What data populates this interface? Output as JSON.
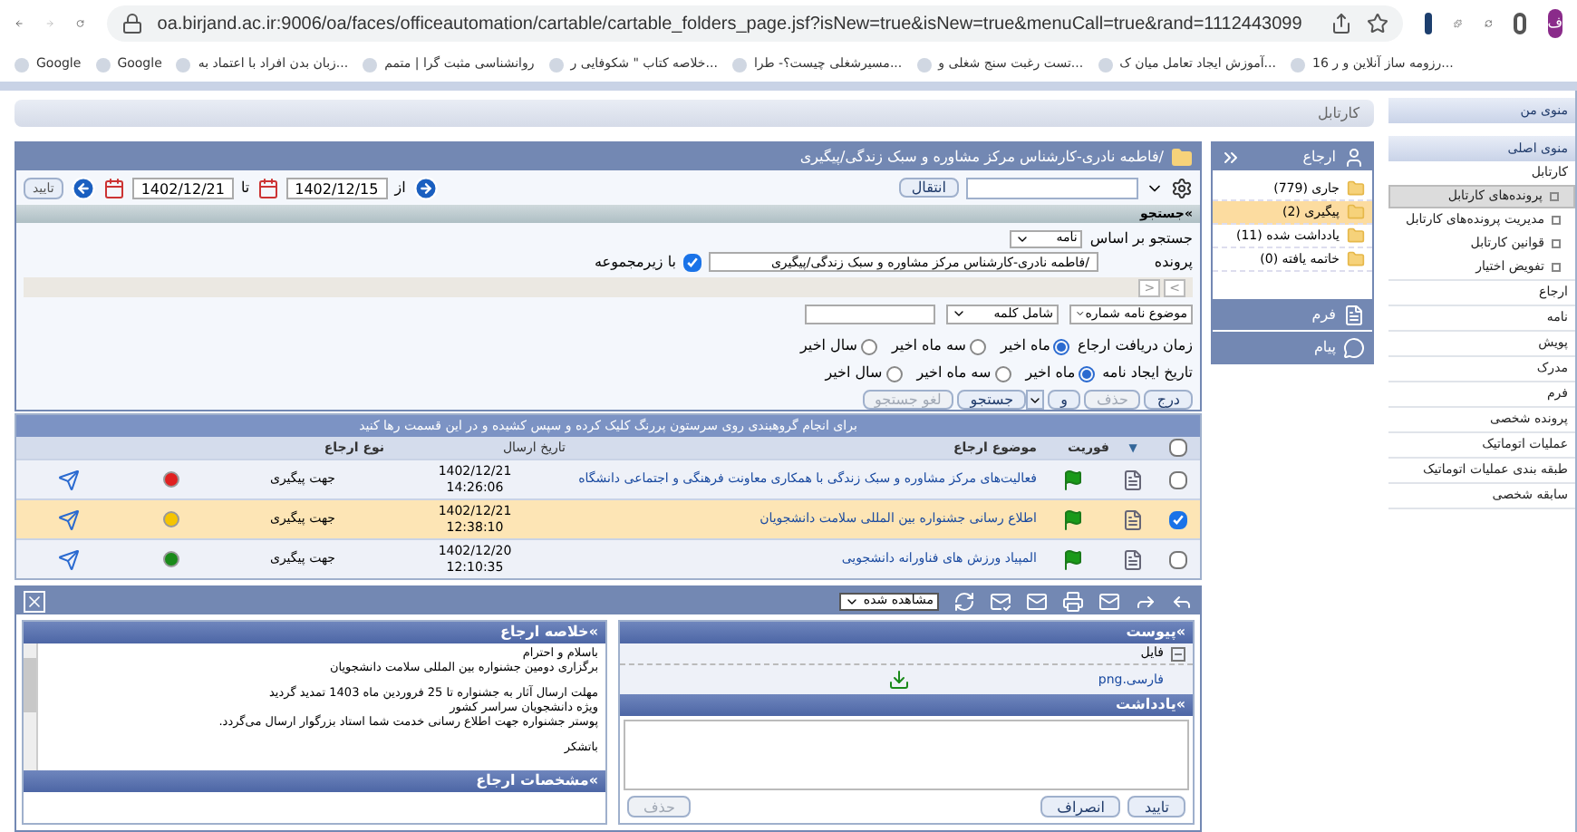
{
  "browser": {
    "url": "oa.birjand.ac.ir:9006/oa/faces/officeautomation/cartable/cartable_folders_page.jsf?isNew=true&isNew=true&menuCall=true&rand=1112443099",
    "profile": "ف",
    "bookmarks": [
      "16 رزومه ساز آنلاین و ر...",
      "آموزش ایجاد تعامل میان ک...",
      "تست رغبت سنج شغلی و...",
      "مسیرشغلی چیست؟- طرا...",
      "خلاصه کتاب \" شکوفایی ر...",
      "روانشناسی مثبت گرا | متمم",
      "زبان بدن افراد با اعتماد به...",
      "Google",
      "Google"
    ]
  },
  "sidebar": {
    "my_menu": "منوی من",
    "main_menu": "منوی اصلی",
    "items": [
      {
        "label": "کارتابل",
        "children": [
          {
            "label": "پرونده‌های کارتابل",
            "selected": true
          },
          {
            "label": "مدیریت پرونده‌های کارتابل",
            "selected": false
          },
          {
            "label": "قوانین کارتابل",
            "selected": false
          },
          {
            "label": "تفویض اختیار",
            "selected": false
          }
        ]
      },
      {
        "label": "ارجاع"
      },
      {
        "label": "نامه"
      },
      {
        "label": "پویش"
      },
      {
        "label": "مدرک"
      },
      {
        "label": "فرم"
      },
      {
        "label": "پرونده شخصی"
      },
      {
        "label": "عملیات اتوماتیک"
      },
      {
        "label": "طبقه بندی عملیات اتوماتیک"
      },
      {
        "label": "سابقه شخصی"
      }
    ]
  },
  "page_title": "کارتابل",
  "cartable": {
    "title": "ارجاع",
    "folders": [
      {
        "name": "جاری",
        "count": "(779)",
        "selected": false
      },
      {
        "name": "پیگیری",
        "count": "(2)",
        "selected": true
      },
      {
        "name": "یادداشت شده",
        "count": "(11)",
        "selected": false
      },
      {
        "name": "خاتمه یافته",
        "count": "(0)",
        "selected": false
      }
    ],
    "sections": [
      {
        "kind": "form",
        "label": "فرم"
      },
      {
        "kind": "message",
        "label": "پیام"
      }
    ]
  },
  "folder_path": "/فاطمه نادری-کارشناس مرکز مشاوره و سبک زندگی/پیگیری",
  "toolbar": {
    "move": "انتقال",
    "from_label": "از",
    "from": "1402/12/15",
    "to_label": "تا",
    "to": "1402/12/21",
    "apply": "تایید"
  },
  "search": {
    "title": "»جستجو",
    "search_by_label": "جستجو بر اساس",
    "search_by": "نامه",
    "folder_label": "پرونده",
    "folder": "/فاطمه نادری-کارشناس مرکز مشاوره و سبک زندگی/پیگیری",
    "with_sub": {
      "label": "با زیرمجموعه",
      "checked": true
    },
    "prev": "<",
    "next": ">",
    "field": "موضوع نامه شماره",
    "condition": "شامل کلمه",
    "radio_groups": [
      {
        "label": "زمان دریافت ارجاع",
        "options": [
          {
            "label": "ماه اخیر",
            "selected": true
          },
          {
            "label": "سه ماه اخیر",
            "selected": false
          },
          {
            "label": "سال اخیر",
            "selected": false
          }
        ]
      },
      {
        "label": "تاریخ ایجاد نامه",
        "options": [
          {
            "label": "ماه اخیر",
            "selected": true
          },
          {
            "label": "سه ماه اخیر",
            "selected": false
          },
          {
            "label": "سال اخیر",
            "selected": false
          }
        ]
      }
    ],
    "buttons": [
      {
        "label": "درج",
        "disabled": false
      },
      {
        "label": "حذف",
        "disabled": true
      },
      {
        "label": "و",
        "disabled": false
      },
      {
        "label": "جستجو",
        "disabled": false,
        "menu": true
      },
      {
        "label": "لغو جستجو",
        "disabled": true
      }
    ]
  },
  "table": {
    "all_checked": false,
    "sort_mark": "▼",
    "group_hint": "برای انجام گروهبندی روی سرستون پررنگ کلیک کرده و سپس کشیده و در این قسمت رها کنید",
    "columns": [
      "فوریت",
      "موضوع ارجاع",
      "تاریخ ارسال",
      "نوع ارجاع"
    ],
    "rows": [
      {
        "subject": "فعالیت‌های مرکز مشاوره و سبک زندگی با همکاری معاونت فرهنگی و اجتماعی دانشگاه",
        "date": "1402/12/21",
        "time": "14:26:06",
        "type": "جهت پیگیری",
        "color": "#e02020",
        "selected": false
      },
      {
        "subject": "اطلاع رسانی جشنواره بین المللی سلامت دانشجویان",
        "date": "1402/12/21",
        "time": "12:38:10",
        "type": "جهت پیگیری",
        "color": "#f5c400",
        "selected": true
      },
      {
        "subject": "المپیاد ورزش های فناورانه دانشجویی",
        "date": "1402/12/20",
        "time": "12:10:35",
        "type": "جهت پیگیری",
        "color": "#1a8a1a",
        "selected": false
      }
    ]
  },
  "detail": {
    "view_state": "مشاهده شده",
    "attachment_title": "»پیوست",
    "file_column": "فایل",
    "files": [
      "فارسی.png"
    ],
    "notes_title": "»یادداشت",
    "notes_buttons": [
      {
        "label": "تایید",
        "disabled": false
      },
      {
        "label": "انصراف",
        "disabled": false
      }
    ],
    "notes_delete": {
      "label": "حذف",
      "disabled": true
    },
    "summary_title": "»خلاصه ارجاع",
    "summary": [
      [
        "باسلام و احترام",
        "برگزاری دومین جشنواره بین المللی سلامت دانشجویان"
      ],
      [
        "مهلت ارسال آثار به جشنواره تا 25 فروردین ماه 1403 تمدید گردید",
        "ویژه دانشجویان سراسر کشور",
        "پوستر جشنواره جهت اطلاع رسانی خدمت شما استاد بزرگوار ارسال می‌گردد."
      ],
      [
        "باتشکر"
      ]
    ],
    "details_title": "»مشخصات ارجاع"
  }
}
